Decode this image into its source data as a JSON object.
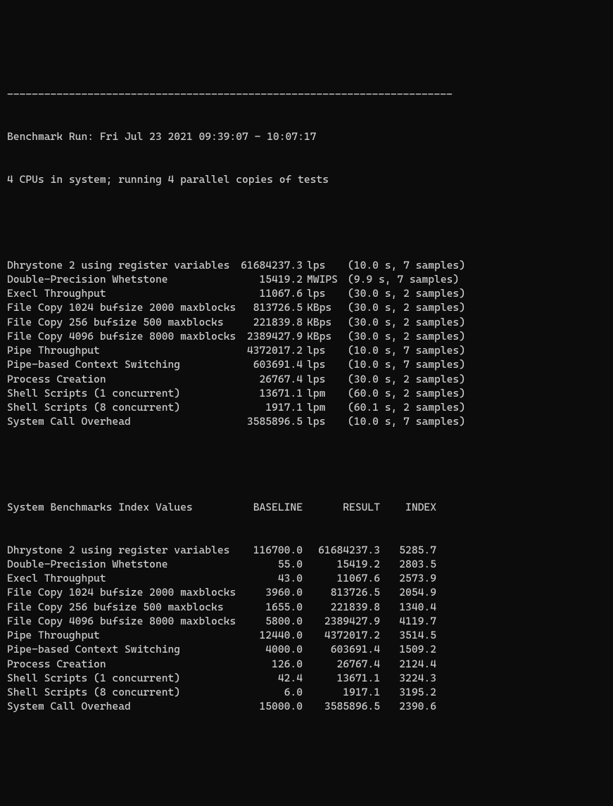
{
  "separator": "------------------------------------------------------------------------",
  "header": {
    "line1": "Benchmark Run: Fri Jul 23 2021 09:39:07 - 10:07:17",
    "line2": "4 CPUs in system; running 4 parallel copies of tests"
  },
  "results": [
    {
      "name": "Dhrystone 2 using register variables",
      "value": "61684237.3",
      "unit": "lps",
      "sample": "(10.0 s, 7 samples)"
    },
    {
      "name": "Double-Precision Whetstone",
      "value": "15419.2",
      "unit": "MWIPS",
      "sample": "(9.9 s, 7 samples)"
    },
    {
      "name": "Execl Throughput",
      "value": "11067.6",
      "unit": "lps",
      "sample": "(30.0 s, 2 samples)"
    },
    {
      "name": "File Copy 1024 bufsize 2000 maxblocks",
      "value": "813726.5",
      "unit": "KBps",
      "sample": "(30.0 s, 2 samples)"
    },
    {
      "name": "File Copy 256 bufsize 500 maxblocks",
      "value": "221839.8",
      "unit": "KBps",
      "sample": "(30.0 s, 2 samples)"
    },
    {
      "name": "File Copy 4096 bufsize 8000 maxblocks",
      "value": "2389427.9",
      "unit": "KBps",
      "sample": "(30.0 s, 2 samples)"
    },
    {
      "name": "Pipe Throughput",
      "value": "4372017.2",
      "unit": "lps",
      "sample": "(10.0 s, 7 samples)"
    },
    {
      "name": "Pipe-based Context Switching",
      "value": "603691.4",
      "unit": "lps",
      "sample": "(10.0 s, 7 samples)"
    },
    {
      "name": "Process Creation",
      "value": "26767.4",
      "unit": "lps",
      "sample": "(30.0 s, 2 samples)"
    },
    {
      "name": "Shell Scripts (1 concurrent)",
      "value": "13671.1",
      "unit": "lpm",
      "sample": "(60.0 s, 2 samples)"
    },
    {
      "name": "Shell Scripts (8 concurrent)",
      "value": "1917.1",
      "unit": "lpm",
      "sample": "(60.1 s, 2 samples)"
    },
    {
      "name": "System Call Overhead",
      "value": "3585896.5",
      "unit": "lps",
      "sample": "(10.0 s, 7 samples)"
    }
  ],
  "index_header": {
    "title": "System Benchmarks Index Values",
    "baseline": "BASELINE",
    "result": "RESULT",
    "index": "INDEX"
  },
  "index": [
    {
      "name": "Dhrystone 2 using register variables",
      "baseline": "116700.0",
      "result": "61684237.3",
      "index": "5285.7"
    },
    {
      "name": "Double-Precision Whetstone",
      "baseline": "55.0",
      "result": "15419.2",
      "index": "2803.5"
    },
    {
      "name": "Execl Throughput",
      "baseline": "43.0",
      "result": "11067.6",
      "index": "2573.9"
    },
    {
      "name": "File Copy 1024 bufsize 2000 maxblocks",
      "baseline": "3960.0",
      "result": "813726.5",
      "index": "2054.9"
    },
    {
      "name": "File Copy 256 bufsize 500 maxblocks",
      "baseline": "1655.0",
      "result": "221839.8",
      "index": "1340.4"
    },
    {
      "name": "File Copy 4096 bufsize 8000 maxblocks",
      "baseline": "5800.0",
      "result": "2389427.9",
      "index": "4119.7"
    },
    {
      "name": "Pipe Throughput",
      "baseline": "12440.0",
      "result": "4372017.2",
      "index": "3514.5"
    },
    {
      "name": "Pipe-based Context Switching",
      "baseline": "4000.0",
      "result": "603691.4",
      "index": "1509.2"
    },
    {
      "name": "Process Creation",
      "baseline": "126.0",
      "result": "26767.4",
      "index": "2124.4"
    },
    {
      "name": "Shell Scripts (1 concurrent)",
      "baseline": "42.4",
      "result": "13671.1",
      "index": "3224.3"
    },
    {
      "name": "Shell Scripts (8 concurrent)",
      "baseline": "6.0",
      "result": "1917.1",
      "index": "3195.2"
    },
    {
      "name": "System Call Overhead",
      "baseline": "15000.0",
      "result": "3585896.5",
      "index": "2390.6"
    }
  ]
}
